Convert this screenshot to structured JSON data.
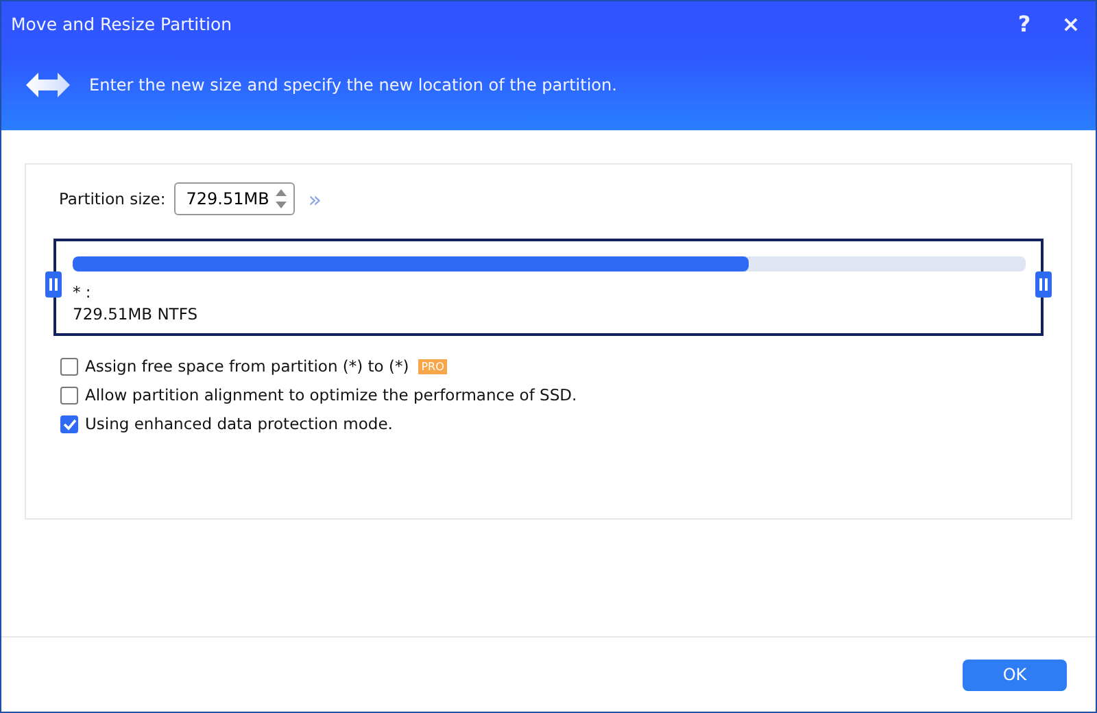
{
  "window": {
    "title": "Move and Resize Partition",
    "help": "?",
    "close": "×"
  },
  "header": {
    "text": "Enter the new size and specify the new location of the partition."
  },
  "size_field": {
    "label": "Partition size:",
    "value": "729.51MB",
    "expand": "»"
  },
  "partition": {
    "name": "* :",
    "info": "729.51MB NTFS",
    "level": 0.71
  },
  "options": [
    {
      "label": "Assign free space from partition (*) to (*)",
      "checked": false,
      "badge": "PRO"
    },
    {
      "label": "Allow partition alignment to optimize the performance of SSD.",
      "checked": false
    },
    {
      "label": "Using enhanced data protection mode.",
      "checked": true
    }
  ],
  "buttons": [
    "OK"
  ]
}
